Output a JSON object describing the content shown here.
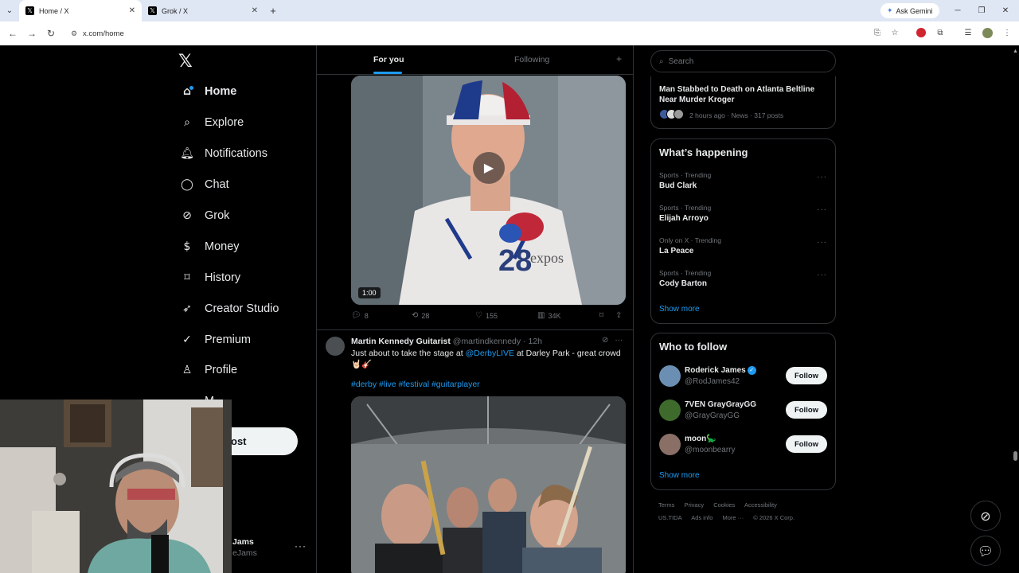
{
  "browser": {
    "tabs": [
      {
        "title": "Home / X",
        "active": true
      },
      {
        "title": "Grok / X",
        "active": false
      }
    ],
    "ask_gemini": "Ask Gemini",
    "url": "x.com/home"
  },
  "sidebar": {
    "items": [
      {
        "label": "Home",
        "icon": "home-icon"
      },
      {
        "label": "Explore",
        "icon": "search-icon"
      },
      {
        "label": "Notifications",
        "icon": "bell-icon"
      },
      {
        "label": "Chat",
        "icon": "chat-icon"
      },
      {
        "label": "Grok",
        "icon": "grok-icon"
      },
      {
        "label": "Money",
        "icon": "money-icon"
      },
      {
        "label": "History",
        "icon": "bookmark-icon"
      },
      {
        "label": "Creator Studio",
        "icon": "rocket-icon"
      },
      {
        "label": "Premium",
        "icon": "verified-icon"
      },
      {
        "label": "Profile",
        "icon": "person-icon"
      },
      {
        "label": "M",
        "icon": "more-circle-icon"
      }
    ],
    "post_label": "ost",
    "account": {
      "name": "Jams",
      "handle": "eJams"
    }
  },
  "feed": {
    "tabs": [
      "For you",
      "Following"
    ],
    "tweet1": {
      "video_duration": "1:00",
      "replies": "8",
      "reposts": "28",
      "likes": "155",
      "views": "34K"
    },
    "tweet2": {
      "name": "Martin Kennedy Guitarist",
      "handle": "@martindkennedy",
      "time": "· 12h",
      "text_before": "Just about to take the stage at ",
      "mention": "@DerbyLIVE",
      "text_after": " at Darley Park - great crowd 🤘🏻🎸",
      "hashtags": "#derby #live #festival #guitarplayer"
    }
  },
  "right": {
    "search_placeholder": "Search",
    "news": {
      "title": "Man Stabbed to Death on Atlanta Beltline Near Murder Kroger",
      "meta": "2 hours ago · News · 317 posts"
    },
    "whats_happening": {
      "heading": "What’s happening",
      "trends": [
        {
          "category": "Sports · Trending",
          "name": "Bud Clark"
        },
        {
          "category": "Sports · Trending",
          "name": "Elijah Arroyo"
        },
        {
          "category": "Only on X · Trending",
          "name": "La Peace"
        },
        {
          "category": "Sports · Trending",
          "name": "Cody Barton"
        }
      ],
      "show_more": "Show more"
    },
    "who_to_follow": {
      "heading": "Who to follow",
      "users": [
        {
          "name": "Roderick James",
          "handle": "@RodJames42",
          "verified": true,
          "avatar_color": "#6b8fb3"
        },
        {
          "name": "7VEN GrayGrayGG",
          "handle": "@GrayGrayGG",
          "verified": false,
          "avatar_color": "#3e6b2c"
        },
        {
          "name": "moon🦕",
          "handle": "@moonbearry",
          "verified": false,
          "avatar_color": "#8a6f66"
        }
      ],
      "follow_label": "Follow",
      "show_more": "Show more"
    },
    "footer": {
      "line1": [
        "Terms",
        "Privacy",
        "Cookies",
        "Accessibility"
      ],
      "line2": [
        "US.TIDA",
        "Ads info",
        "More ···",
        "© 2026 X Corp."
      ]
    }
  },
  "colors": {
    "accent": "#1d9bf0",
    "background": "#000000",
    "text": "#e7e9ea",
    "muted": "#71767b"
  }
}
